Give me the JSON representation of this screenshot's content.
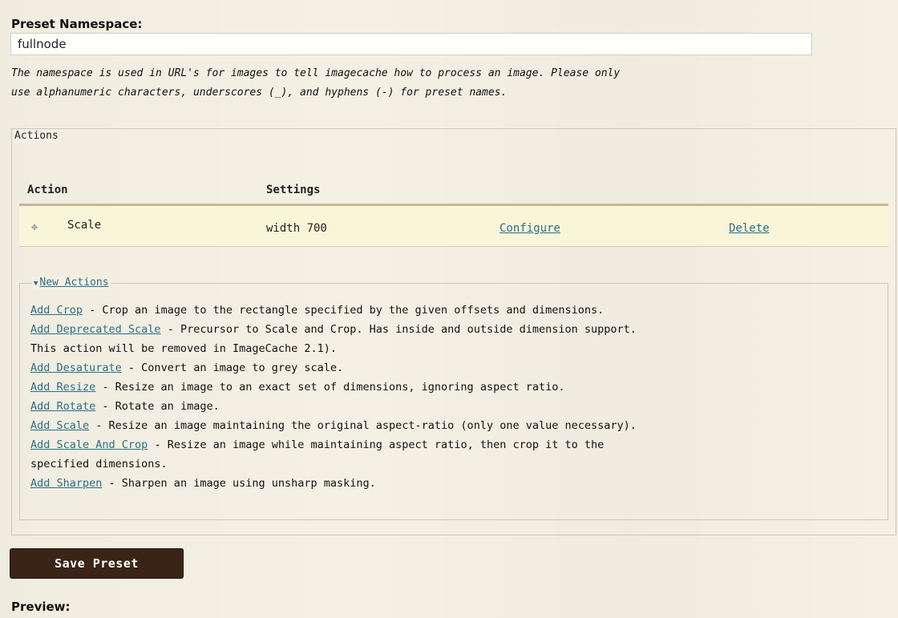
{
  "namespace": {
    "label": "Preset Namespace:",
    "value": "fullnode",
    "description_line1": "The namespace is used in URL's for images to tell imagecache how to process an image. Please only",
    "description_line2": "use alphanumeric characters, underscores (_), and hyphens (-) for preset names."
  },
  "actions": {
    "legend": "Actions",
    "headers": {
      "action": "Action",
      "settings": "Settings"
    },
    "row": {
      "drag_icon": "drag-handle",
      "action": "Scale",
      "settings": "width 700",
      "configure": "Configure",
      "delete": "Delete"
    }
  },
  "new_actions": {
    "legend": "New Actions",
    "items": [
      {
        "link": "Add Crop",
        "text": " - Crop an image to the rectangle specified by the given offsets and dimensions."
      },
      {
        "link": "Add Deprecated Scale",
        "text": " - Precursor to Scale and Crop. Has inside and outside dimension support."
      },
      {
        "link": "",
        "text": "This action will be removed in ImageCache 2.1)."
      },
      {
        "link": "Add Desaturate",
        "text": " - Convert an image to grey scale."
      },
      {
        "link": "Add Resize",
        "text": " - Resize an image to an exact set of dimensions, ignoring aspect ratio."
      },
      {
        "link": "Add Rotate",
        "text": " - Rotate an image."
      },
      {
        "link": "Add Scale",
        "text": " - Resize an image maintaining the original aspect-ratio (only one value necessary)."
      },
      {
        "link": "Add Scale And Crop",
        "text": " - Resize an image while maintaining aspect ratio, then crop it to the"
      },
      {
        "link": "",
        "text": "specified dimensions."
      },
      {
        "link": "Add Sharpen",
        "text": " - Sharpen an image using unsharp masking."
      }
    ]
  },
  "save_button": "Save Preset",
  "preview_label": "Preview:",
  "colors": {
    "link": "#2a6f8a",
    "button_bg": "#3a2418",
    "row_bg": "#f8f5d8",
    "page_bg": "#f4f0e3"
  }
}
